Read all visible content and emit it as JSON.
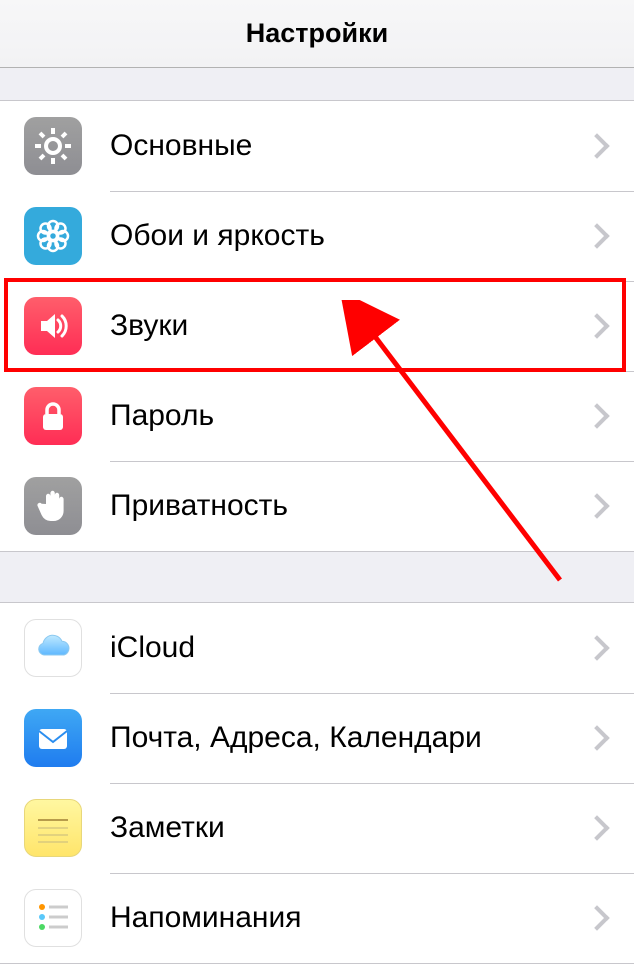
{
  "header": {
    "title": "Настройки"
  },
  "group1": [
    {
      "id": "general",
      "icon": "gear-icon",
      "label": "Основные"
    },
    {
      "id": "wallpaper",
      "icon": "flower-icon",
      "label": "Обои и яркость"
    },
    {
      "id": "sounds",
      "icon": "speaker-icon",
      "label": "Звуки"
    },
    {
      "id": "passcode",
      "icon": "lock-icon",
      "label": "Пароль"
    },
    {
      "id": "privacy",
      "icon": "hand-icon",
      "label": "Приватность"
    }
  ],
  "group2": [
    {
      "id": "icloud",
      "icon": "cloud-icon",
      "label": "iCloud"
    },
    {
      "id": "mail",
      "icon": "envelope-icon",
      "label": "Почта, Адреса, Календари"
    },
    {
      "id": "notes",
      "icon": "notes-icon",
      "label": "Заметки"
    },
    {
      "id": "reminders",
      "icon": "reminders-icon",
      "label": "Напоминания"
    }
  ],
  "annotation": {
    "highlight_target": "sounds",
    "arrow_color": "#ff0000"
  }
}
